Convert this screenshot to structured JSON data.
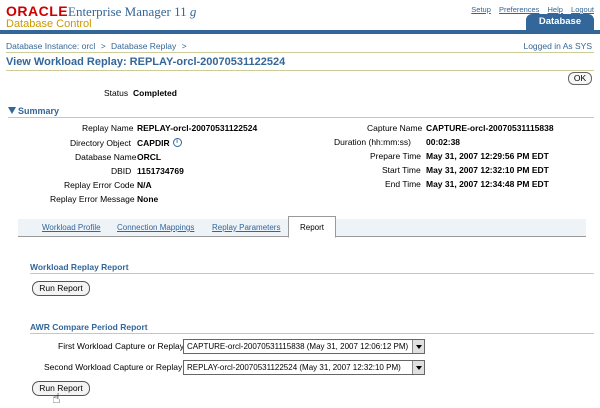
{
  "brand": {
    "oracle": "ORACLE",
    "em": "Enterprise Manager 11",
    "em_ver": "g",
    "product": "Database Control",
    "tab": "Database"
  },
  "global_links": [
    "Setup",
    "Preferences",
    "Help",
    "Logout"
  ],
  "breadcrumb": {
    "items": [
      "Database Instance: orcl",
      "Database Replay"
    ],
    "sep": ">"
  },
  "login": "Logged in As SYS",
  "page_title": "View Workload Replay: REPLAY-orcl-20070531122524",
  "ok_label": "OK",
  "status": {
    "label": "Status",
    "value": "Completed"
  },
  "summary": {
    "header": "Summary",
    "left": [
      {
        "label": "Replay Name",
        "value": "REPLAY-orcl-20070531122524"
      },
      {
        "label": "Directory Object",
        "value": "CAPDIR"
      },
      {
        "label": "Database Name",
        "value": "ORCL"
      },
      {
        "label": "DBID",
        "value": "1151734769"
      },
      {
        "label": "Replay Error Code",
        "value": "N/A"
      },
      {
        "label": "Replay Error Message",
        "value": "None"
      }
    ],
    "right": [
      {
        "label": "Capture Name",
        "value": "CAPTURE-orcl-20070531115838"
      },
      {
        "label": "Duration (hh:mm:ss)",
        "value": "00:02:38"
      },
      {
        "label": "Prepare Time",
        "value": "May 31, 2007 12:29:56 PM EDT"
      },
      {
        "label": "Start Time",
        "value": "May 31, 2007 12:32:10 PM EDT"
      },
      {
        "label": "End Time",
        "value": "May 31, 2007 12:34:48 PM EDT"
      }
    ]
  },
  "tabs": [
    "Workload Profile",
    "Connection Mappings",
    "Replay Parameters",
    "Report"
  ],
  "workload_report": {
    "header": "Workload Replay Report",
    "button": "Run Report"
  },
  "awr": {
    "header": "AWR Compare Period Report",
    "first_label": "First Workload Capture or Replay",
    "first_value": "CAPTURE-orcl-20070531115838 (May 31, 2007 12:06:12 PM)",
    "second_label": "Second Workload Capture or Replay",
    "second_value": "REPLAY-orcl-20070531122524 (May 31, 2007 12:32:10 PM)",
    "button": "Run Report"
  }
}
